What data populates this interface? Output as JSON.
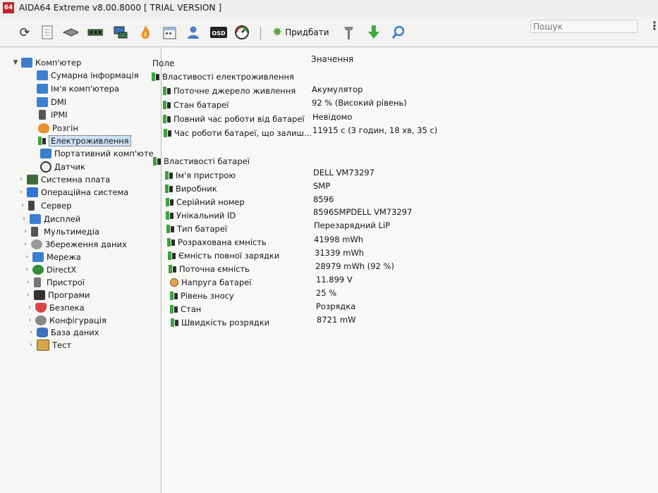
{
  "window": {
    "logo": "64",
    "title": "AIDA64 Extreme v8.00.8000  [ TRIAL VERSION ]"
  },
  "toolbar": {
    "icons": [
      "refresh-icon",
      "report-icon",
      "motherboard-icon",
      "memory-icon",
      "network-icon",
      "flame-icon",
      "calendar-icon",
      "user-icon",
      "osd-icon",
      "gauge-icon"
    ],
    "add_label": "Придбати",
    "search_placeholder": "Пошук"
  },
  "tree": {
    "root": "Комп'ютер",
    "children": [
      "Сумарна інформація",
      "Ім'я комп'ютера",
      "DMI",
      "IPMI",
      "Розгін",
      "Електроживлення",
      "Портативний комп'юте",
      "Датчик"
    ],
    "selected": "Електроживлення",
    "groups": [
      "Системна плата",
      "Операційна система",
      "Сервер",
      "Дисплей",
      "Мультимедіа",
      "Збереження даних",
      "Мережа",
      "DirectX",
      "Пристрої",
      "Програми",
      "Безпека",
      "Конфігурація",
      "База даних",
      "Тест"
    ]
  },
  "table": {
    "col_field": "Поле",
    "col_value": "Значення",
    "section1": {
      "title": "Властивості електроживлення",
      "rows": [
        {
          "field": "Поточне джерело живлення",
          "value": "Акумулятор"
        },
        {
          "field": "Стан батареї",
          "value": "92 % (Високий рівень)"
        },
        {
          "field": "Повний час роботи від батареї",
          "value": "Невідомо"
        },
        {
          "field": "Час роботи батареї, що залиш...",
          "value": "11915 с (3 годин, 18 хв, 35 с)"
        }
      ]
    },
    "section2": {
      "title": "Властивості батареї",
      "rows": [
        {
          "field": "Ім'я пристрою",
          "value": "DELL VM73297"
        },
        {
          "field": "Виробник",
          "value": "SMP"
        },
        {
          "field": "Серійний номер",
          "value": "8596"
        },
        {
          "field": "Унікальний ID",
          "value": "8596SMPDELL VM73297"
        },
        {
          "field": "Тип батареї",
          "value": "Перезарядний LiP"
        },
        {
          "field": "Розрахована ємність",
          "value": "41998 mWh"
        },
        {
          "field": "Ємність повної зарядки",
          "value": "31339 mWh"
        },
        {
          "field": "Поточна ємність",
          "value": "28979 mWh  (92 %)"
        },
        {
          "field": "Напруга батареї",
          "value": "11.899 V"
        },
        {
          "field": "Рівень зносу",
          "value": "25 %"
        },
        {
          "field": "Стан",
          "value": "Розрядка"
        },
        {
          "field": "Швидкість розрядки",
          "value": "8721 mW"
        }
      ]
    }
  }
}
